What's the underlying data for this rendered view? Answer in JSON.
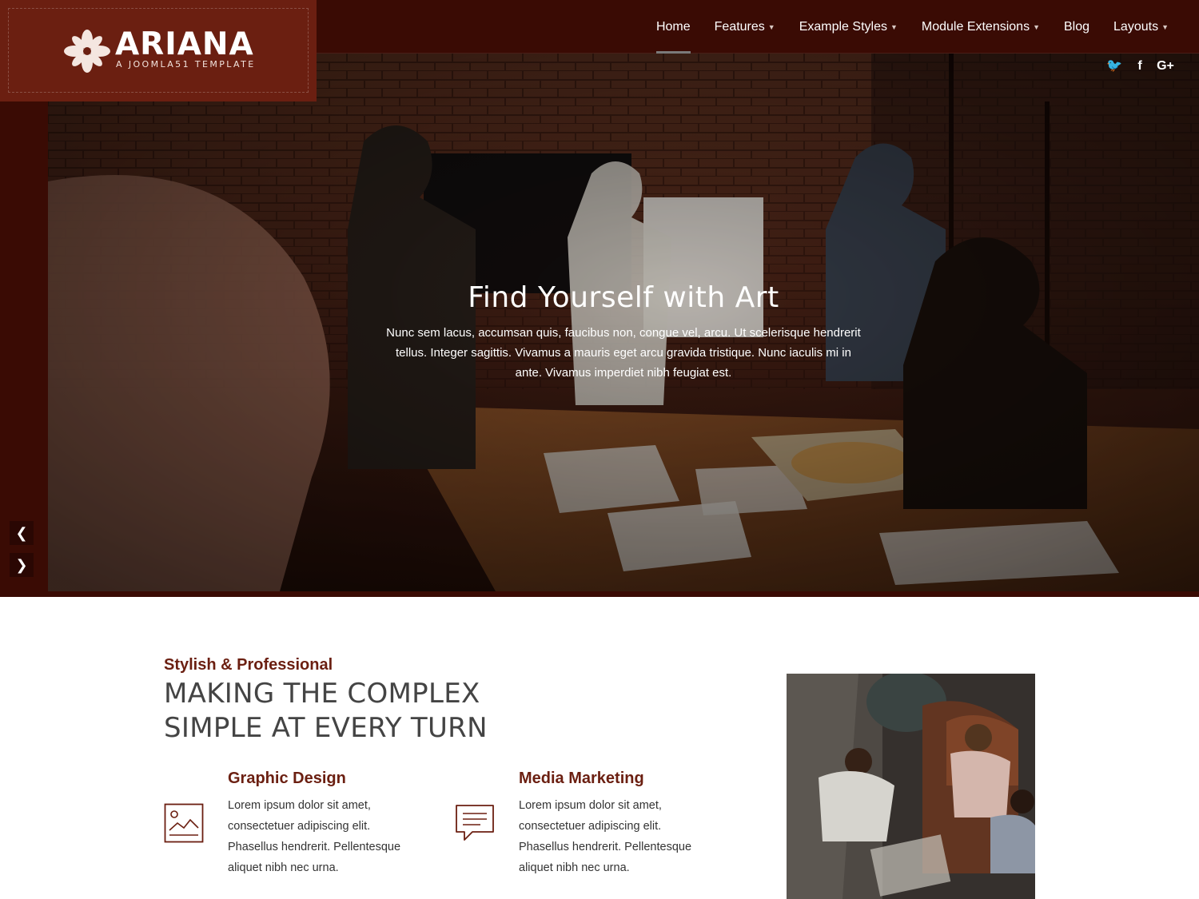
{
  "brand": {
    "name": "ARIANA",
    "tagline": "A JOOMLA51 TEMPLATE",
    "accent_color": "#6b1f11",
    "dark_color": "#3a0b04"
  },
  "nav": {
    "items": [
      {
        "label": "Home",
        "active": true,
        "has_dropdown": false
      },
      {
        "label": "Features",
        "has_dropdown": true
      },
      {
        "label": "Example Styles",
        "has_dropdown": true
      },
      {
        "label": "Module Extensions",
        "has_dropdown": true
      },
      {
        "label": "Blog",
        "has_dropdown": false
      },
      {
        "label": "Layouts",
        "has_dropdown": true
      }
    ],
    "caret_icon": "caret-down-icon"
  },
  "social": {
    "twitter_glyph": "🐦",
    "facebook_glyph": "f",
    "googleplus_glyph": "G+"
  },
  "hero": {
    "title": "Find Yourself with Art",
    "text": "Nunc sem lacus, accumsan quis, faucibus non, congue vel, arcu. Ut scelerisque hendrerit tellus. Integer sagittis. Vivamus a mauris eget arcu gravida tristique. Nunc iaculis mi in ante. Vivamus imperdiet nibh feugiat est.",
    "prev_glyph": "❮",
    "next_glyph": "❯"
  },
  "intro": {
    "eyebrow": "Stylish & Professional",
    "heading_line1": "MAKING THE COMPLEX",
    "heading_line2": "SIMPLE AT EVERY TURN"
  },
  "features": [
    {
      "title": "Graphic Design",
      "text": "Lorem ipsum dolor sit amet, consectetuer adipiscing elit. Phasellus hendrerit. Pellentesque aliquet nibh nec urna.",
      "icon": "image-icon"
    },
    {
      "title": "Media Marketing",
      "text": "Lorem ipsum dolor sit amet, consectetuer adipiscing elit. Phasellus hendrerit. Pellentesque aliquet nibh nec urna.",
      "icon": "chat-icon"
    }
  ]
}
